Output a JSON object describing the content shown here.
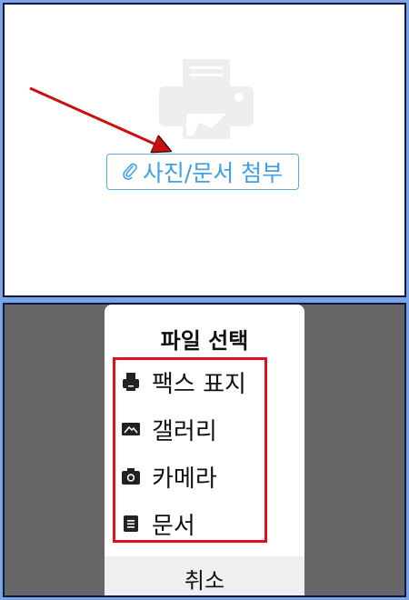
{
  "top_screen": {
    "attach_button_label": "사진/문서 첨부"
  },
  "file_picker": {
    "title": "파일 선택",
    "options": [
      {
        "label": "팩스 표지",
        "icon": "fax-icon"
      },
      {
        "label": "갤러리",
        "icon": "gallery-icon"
      },
      {
        "label": "카메라",
        "icon": "camera-icon"
      },
      {
        "label": "문서",
        "icon": "document-icon"
      }
    ],
    "cancel_label": "취소"
  },
  "colors": {
    "accent": "#3fa0e4",
    "highlight": "#e20f1d",
    "arrow": "#cc1010"
  }
}
